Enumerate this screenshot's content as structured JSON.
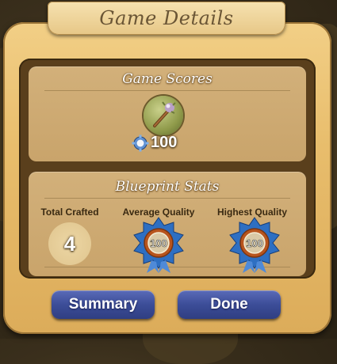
{
  "dialog": {
    "title": "Game Details"
  },
  "scores_section": {
    "title": "Game Scores",
    "item_icon": "crafted-wand-icon",
    "score_icon": "gear-icon",
    "score": "100"
  },
  "blueprint_section": {
    "title": "Blueprint Stats",
    "columns": [
      {
        "label": "Total Crafted",
        "value": "4"
      },
      {
        "label": "Average Quality",
        "value": "100",
        "icon": "quality-medal-icon"
      },
      {
        "label": "Highest Quality",
        "value": "100",
        "icon": "quality-medal-icon"
      }
    ]
  },
  "buttons": {
    "summary": "Summary",
    "done": "Done"
  },
  "colors": {
    "panel": "#e8bd6c",
    "button": "#3c4d98",
    "medal": "#2e6fc2"
  }
}
